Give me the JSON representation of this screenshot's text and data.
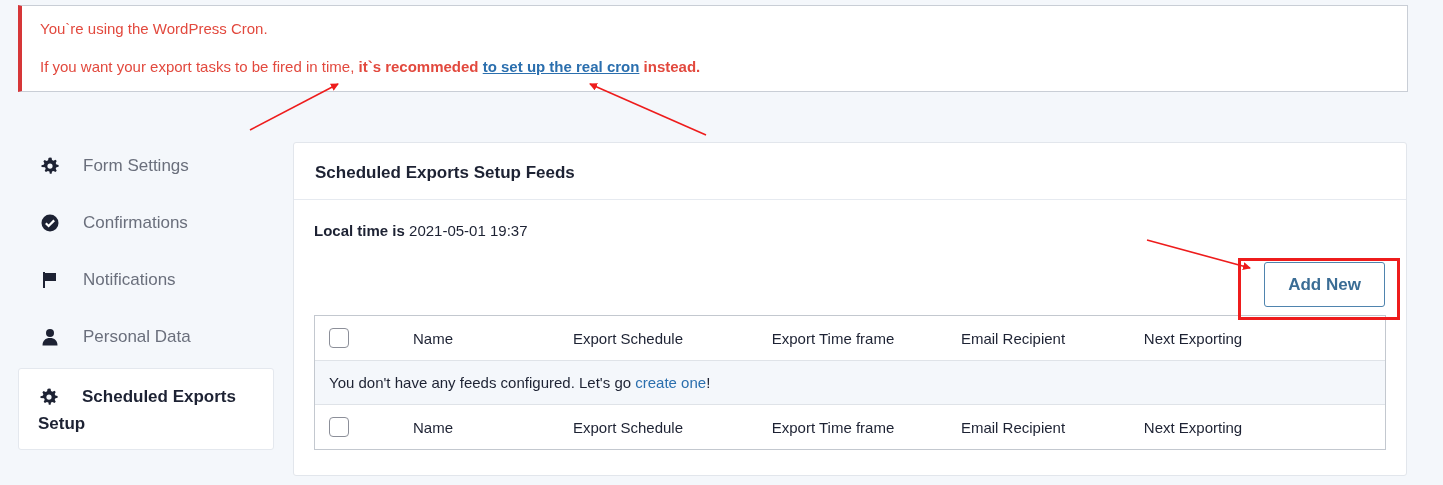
{
  "notice": {
    "lines": [
      {
        "text": "You`re using the WordPress Cron."
      },
      {
        "text": "If you want your export tasks to be fired in time, **it`s recommeded**",
        "link": "to set up the real cron",
        "after": " **instead.**"
      }
    ]
  },
  "sidebar": {
    "items": [
      {
        "label": "Form Settings",
        "kind": "gear",
        "selected": false
      },
      {
        "label": "Confirmations",
        "kind": "check",
        "selected": false
      },
      {
        "label": "Notifications",
        "kind": "flag",
        "selected": false
      },
      {
        "label": "Personal Data",
        "kind": "person",
        "selected": false
      },
      {
        "label": "Scheduled Exports Setup",
        "kind": "gear",
        "selected": true
      }
    ]
  },
  "panel": {
    "title": "Scheduled Exports Setup Feeds",
    "local_time_label": "Local time is",
    "local_time": "2021-05-01 19:37",
    "add_button": "Add New",
    "table": {
      "columns": [
        "Name",
        "Export Schedule",
        "Export Time frame",
        "Email Recipient",
        "Next Exporting"
      ],
      "footer_columns": [
        "Name",
        "Export Schedule",
        "Export Time frame",
        "Email Recipient",
        "Next Exporting"
      ],
      "header_checked": false,
      "footer_checked": false,
      "empty_message": "You don't have any feeds configured. Let's go ",
      "empty_link": "create one",
      "empty_after": "!"
    }
  },
  "annotations": [
    {
      "kind": "arrow"
    },
    {
      "kind": "arrow"
    },
    {
      "kind": "arrow"
    },
    {
      "kind": "box"
    }
  ]
}
